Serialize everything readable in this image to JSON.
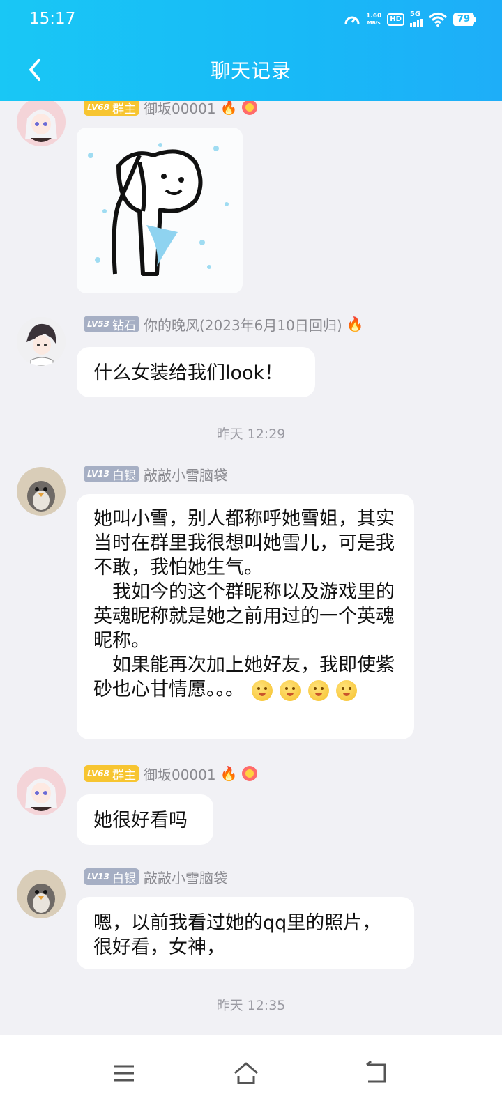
{
  "status_bar": {
    "time": "15:17",
    "net_speed_value": "1.60",
    "net_speed_unit": "MB/s",
    "hd": "HD",
    "network": "5G",
    "battery": "79"
  },
  "header": {
    "title": "聊天记录"
  },
  "messages": [
    {
      "level": "LV68",
      "role": "群主",
      "nickname": "御坂00001",
      "type": "sticker"
    },
    {
      "level": "LV53",
      "role": "钻石",
      "nickname": "你的晚风(2023年6月10日回归)",
      "text": "什么女装给我们look！"
    },
    {
      "timestamp": "昨天 12:29"
    },
    {
      "level": "LV13",
      "role": "白银",
      "nickname": "敲敲小雪脑袋",
      "text": "她叫小雪，别人都称呼她雪姐，其实当时在群里我很想叫她雪儿，可是我不敢，我怕她生气。\n　我如今的这个群昵称以及游戏里的英魂昵称就是她之前用过的一个英魂昵称。\n　如果能再次加上她好友，我即使紫砂也心甘情愿。。。"
    },
    {
      "level": "LV68",
      "role": "群主",
      "nickname": "御坂00001",
      "text": "她很好看吗"
    },
    {
      "level": "LV13",
      "role": "白银",
      "nickname": "敲敲小雪脑袋",
      "text": "嗯，以前我看过她的qq里的照片，很好看，女神，"
    },
    {
      "timestamp": "昨天 12:35"
    }
  ],
  "colors": {
    "header": "#19c7f5",
    "background": "#f1f1f5",
    "gold_badge": "#f7c531",
    "gray_badge": "#a6afc4"
  }
}
